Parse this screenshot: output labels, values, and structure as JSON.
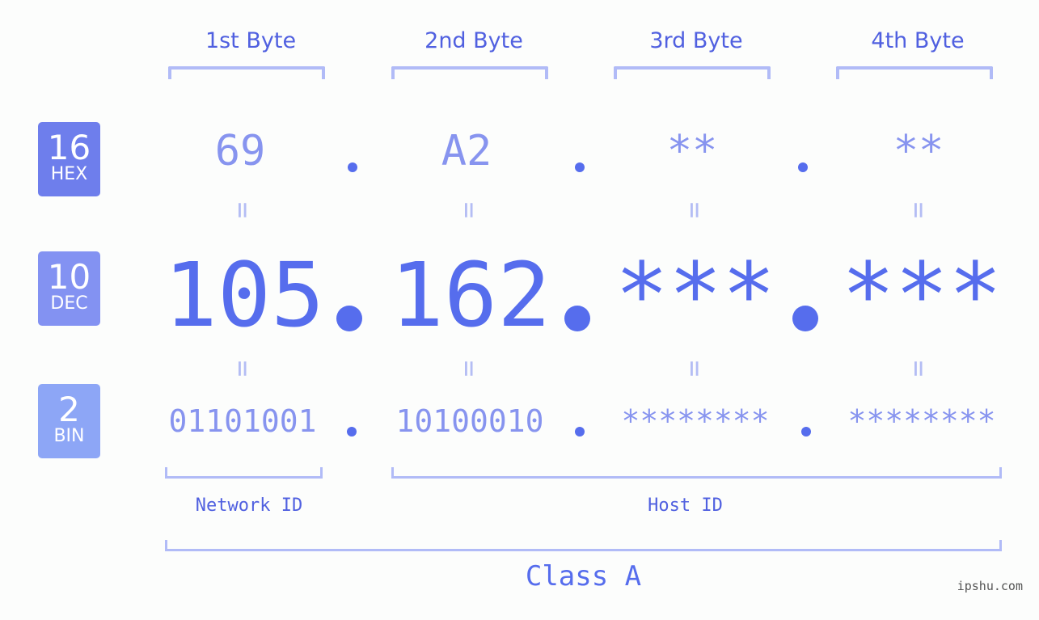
{
  "colors": {
    "hex_badge": "#6e7eec",
    "dec_badge": "#8392f2",
    "bin_badge": "#8da6f6",
    "primary_text": "#5060e0",
    "value_light": "#8794ef",
    "value_dark": "#566ded",
    "bracket": "#b1bbf7"
  },
  "badges": [
    {
      "number": "16",
      "label": "HEX"
    },
    {
      "number": "10",
      "label": "DEC"
    },
    {
      "number": "2",
      "label": "BIN"
    }
  ],
  "byte_headers": [
    "1st Byte",
    "2nd Byte",
    "3rd Byte",
    "4th Byte"
  ],
  "hex_values": [
    "69",
    "A2",
    "**",
    "**"
  ],
  "dec_values": [
    "105",
    "162",
    "***",
    "***"
  ],
  "bin_values": [
    "01101001",
    "10100010",
    "********",
    "********"
  ],
  "separator": ".",
  "equals": "=",
  "network_id_label": "Network ID",
  "host_id_label": "Host ID",
  "class_label": "Class A",
  "watermark": "ipshu.com"
}
